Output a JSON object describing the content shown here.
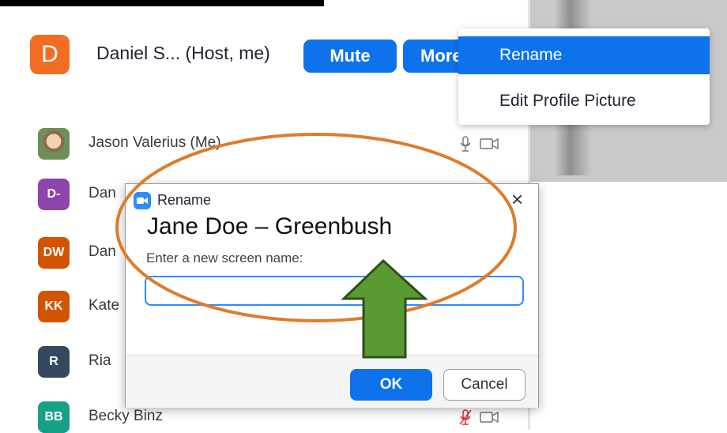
{
  "host": {
    "initial": "D",
    "name": "Daniel S... (Host, me)",
    "mute_label": "Mute",
    "more_label": "More"
  },
  "context_menu": {
    "items": [
      {
        "label": "Rename"
      },
      {
        "label": "Edit Profile Picture"
      }
    ]
  },
  "participants": [
    {
      "initials": "",
      "name": "Jason Valerius (Me)",
      "color": "#6f8f5a",
      "mic": "on"
    },
    {
      "initials": "D-",
      "name": "Dan",
      "color": "#8e44ad"
    },
    {
      "initials": "DW",
      "name": "Dan",
      "color": "#d35400"
    },
    {
      "initials": "KK",
      "name": "Kate",
      "color": "#d35400"
    },
    {
      "initials": "R",
      "name": "Ria",
      "color": "#34495e"
    },
    {
      "initials": "BB",
      "name": "Becky Binz",
      "color": "#16a085",
      "mic": "muted"
    }
  ],
  "dialog": {
    "title": "Rename",
    "close_glyph": "×",
    "prompt": "Enter a new screen name:",
    "input_value": "",
    "ok_label": "OK",
    "cancel_label": "Cancel"
  },
  "annotation": {
    "text": "Jane Doe – Greenbush",
    "ellipse_color": "#e07b2a",
    "arrow_color": "#5a9a32"
  },
  "colors": {
    "accent": "#0e72ed",
    "host_avatar": "#f26d21"
  }
}
